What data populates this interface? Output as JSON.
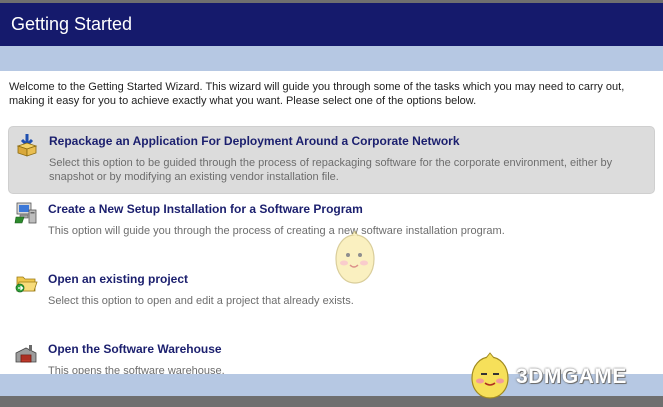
{
  "header": {
    "title": "Getting Started"
  },
  "intro": "Welcome to the Getting Started Wizard. This wizard will guide you through some of the tasks which you may need to carry out, making it easy for you to achieve exactly what you want. Please select one of the options below.",
  "options": [
    {
      "title": "Repackage an Application For Deployment Around a Corporate Network",
      "desc": "Select this option to be guided through the process of repackaging software for the corporate environment, either by snapshot or by modifying an existing vendor installation file.",
      "icon": "repackage-box-icon",
      "selected": true
    },
    {
      "title": "Create a New Setup Installation for a Software Program",
      "desc": "This option will guide you through the process of creating a new software installation program.",
      "icon": "computer-setup-icon",
      "selected": false
    },
    {
      "title": "Open an existing project",
      "desc": "Select this option to open and edit a project that already exists.",
      "icon": "open-folder-icon",
      "selected": false
    },
    {
      "title": "Open the Software Warehouse",
      "desc": "This opens the software warehouse.",
      "icon": "warehouse-icon",
      "selected": false
    }
  ],
  "watermark": {
    "text": "3DMGAME"
  },
  "colors": {
    "header_bg": "#151a6c",
    "band": "#b6c8e3",
    "title_text": "#1b1f6e",
    "selected_bg": "#dcdcdc"
  }
}
